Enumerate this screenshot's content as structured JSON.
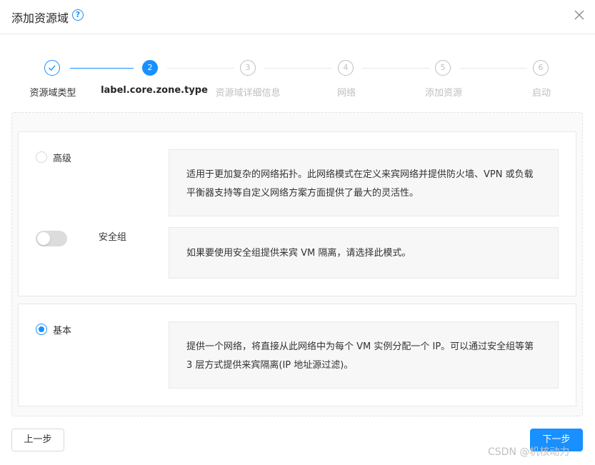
{
  "dialog": {
    "title": "添加资源域",
    "help_icon": "question-circle-icon",
    "close_icon": "close-icon"
  },
  "steps": [
    {
      "number": "1",
      "label": "资源域类型",
      "state": "done"
    },
    {
      "number": "2",
      "label": "label.core.zone.type",
      "state": "active"
    },
    {
      "number": "3",
      "label": "资源域详细信息",
      "state": "pending"
    },
    {
      "number": "4",
      "label": "网络",
      "state": "pending"
    },
    {
      "number": "5",
      "label": "添加资源",
      "state": "pending"
    },
    {
      "number": "6",
      "label": "启动",
      "state": "pending"
    }
  ],
  "options": {
    "advanced": {
      "label": "高级",
      "selected": false,
      "description": "适用于更加复杂的网络拓扑。此网络模式在定义来宾网络并提供防火墙、VPN 或负载平衡器支持等自定义网络方案方面提供了最大的灵活性。",
      "security_group": {
        "label": "安全组",
        "enabled": false,
        "description": "如果要使用安全组提供来宾 VM 隔离，请选择此模式。"
      }
    },
    "basic": {
      "label": "基本",
      "selected": true,
      "description": "提供一个网络，将直接从此网络中为每个 VM 实例分配一个 IP。可以通过安全组等第 3 层方式提供来宾隔离(IP 地址源过滤)。"
    }
  },
  "footer": {
    "prev_label": "上一步",
    "next_label": "下一步"
  },
  "watermark": "CSDN @机核动力",
  "colors": {
    "primary": "#1890ff",
    "border": "#e8e8e8",
    "muted": "#bfbfbf"
  }
}
